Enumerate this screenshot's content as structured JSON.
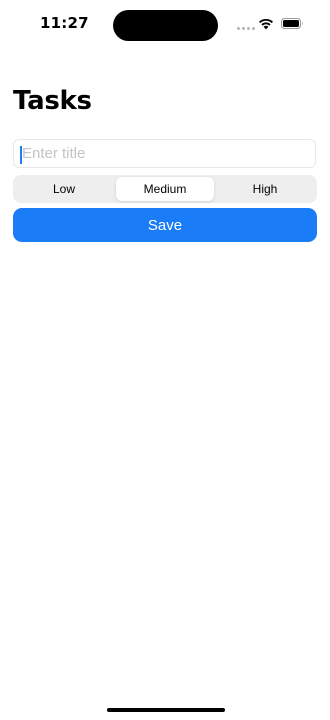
{
  "status_bar": {
    "time": "11:27",
    "icons": [
      "signal-dots-icon",
      "wifi-icon",
      "battery-icon"
    ]
  },
  "header": {
    "title": "Tasks"
  },
  "form": {
    "title_input": {
      "value": "",
      "placeholder": "Enter title"
    },
    "priority": {
      "options": [
        "Low",
        "Medium",
        "High"
      ],
      "selected": "Medium"
    },
    "save_label": "Save"
  },
  "colors": {
    "accent": "#1a7cf7",
    "segment_bg": "#eeeeef",
    "placeholder": "#c4c4c8"
  }
}
